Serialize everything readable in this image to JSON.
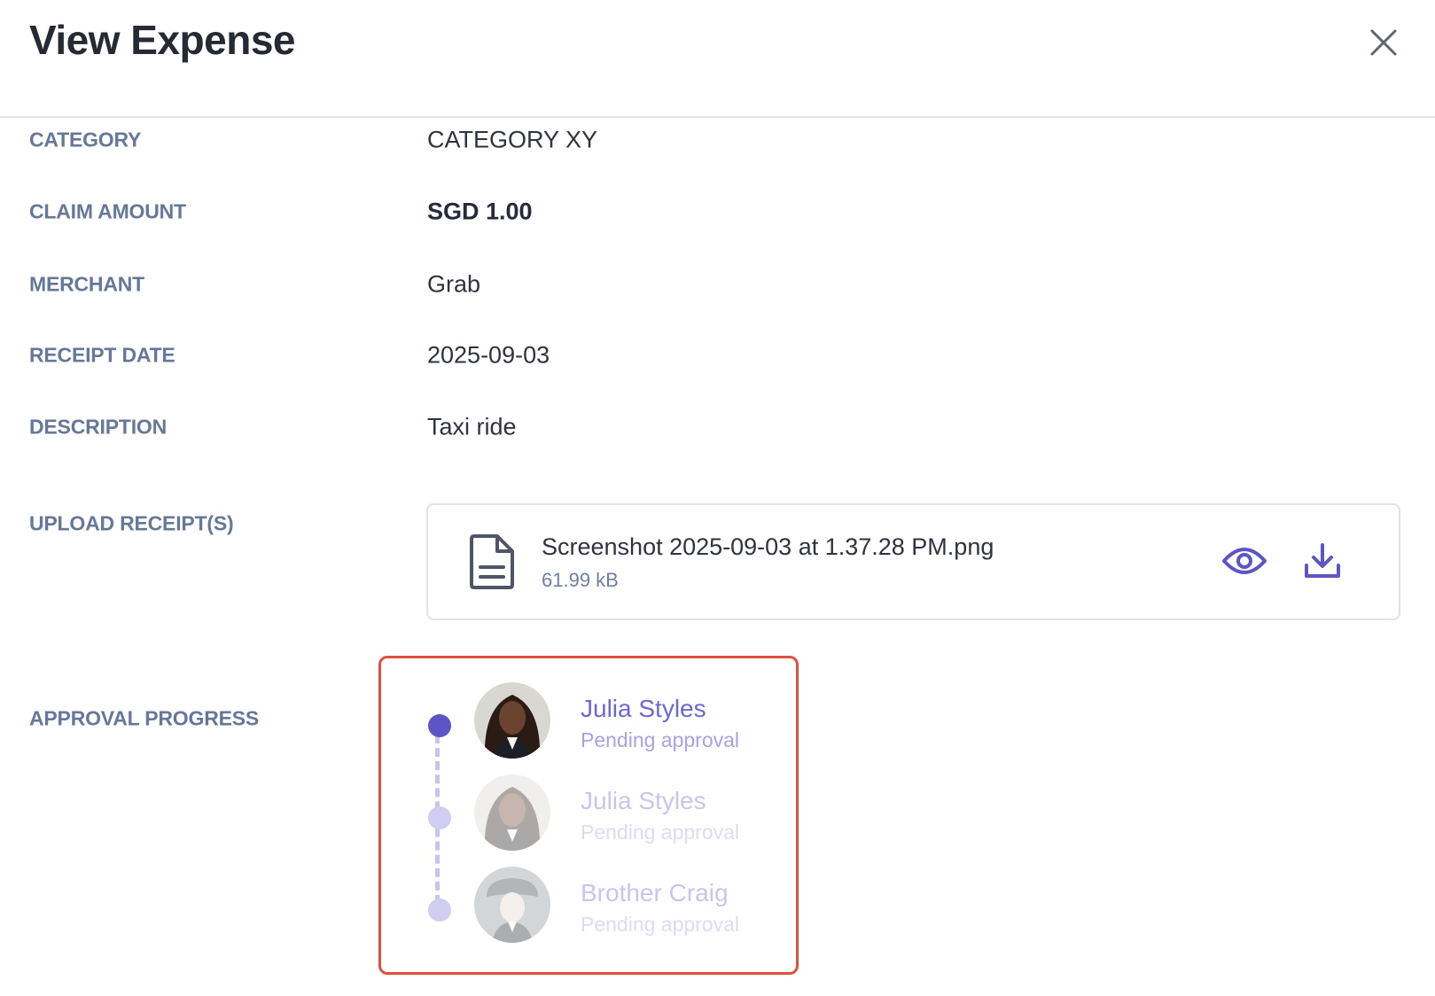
{
  "dialog": {
    "title": "View Expense",
    "close_icon": "close-icon"
  },
  "fields": {
    "category": {
      "label": "CATEGORY",
      "value": "CATEGORY XY"
    },
    "claim_amount": {
      "label": "CLAIM AMOUNT",
      "value": "SGD 1.00"
    },
    "merchant": {
      "label": "MERCHANT",
      "value": "Grab"
    },
    "receipt_date": {
      "label": "RECEIPT DATE",
      "value": "2025-09-03"
    },
    "description": {
      "label": "DESCRIPTION",
      "value": "Taxi ride"
    }
  },
  "receipts": {
    "label": "UPLOAD RECEIPT(S)",
    "files": [
      {
        "name": "Screenshot 2025-09-03 at 1.37.28 PM.png",
        "size": "61.99 kB",
        "icon": "document-icon"
      }
    ],
    "actions": {
      "view_icon": "eye-icon",
      "download_icon": "download-icon"
    }
  },
  "approval": {
    "label": "APPROVAL PROGRESS",
    "approvers": [
      {
        "name": "Julia Styles",
        "status": "Pending approval",
        "active": true
      },
      {
        "name": "Julia Styles",
        "status": "Pending approval",
        "active": false
      },
      {
        "name": "Brother Craig",
        "status": "Pending approval",
        "active": false
      }
    ]
  },
  "colors": {
    "accent": "#5b55c6",
    "label": "#65789a",
    "highlight_border": "#e0503d",
    "timeline_inactive": "#c6c4ec"
  }
}
